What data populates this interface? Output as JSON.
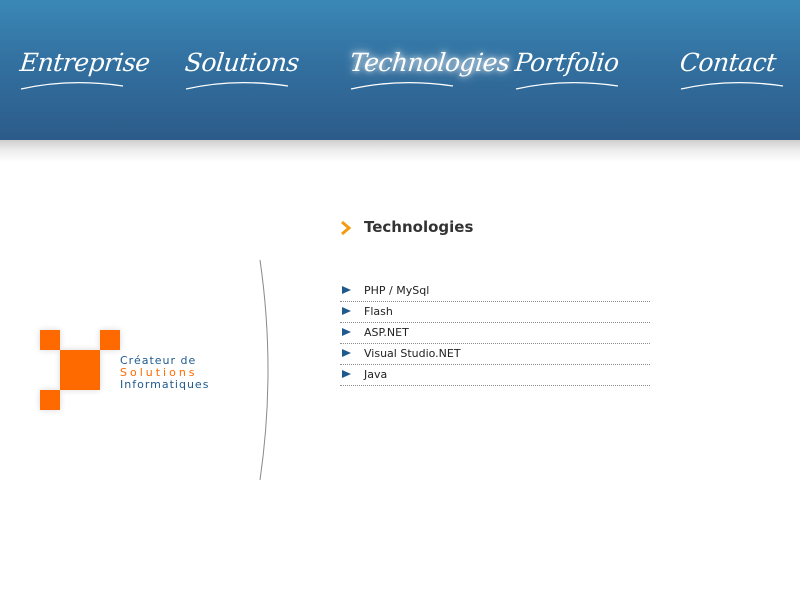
{
  "nav": {
    "items": [
      {
        "label": "Entreprise"
      },
      {
        "label": "Solutions"
      },
      {
        "label": "Technologies",
        "active": true
      },
      {
        "label": "Portfolio"
      },
      {
        "label": "Contact"
      }
    ]
  },
  "logo": {
    "line1": "Créateur de",
    "line2": "Solutions",
    "line3": "Informatiques",
    "colors": {
      "squares": "#ff6a00",
      "text_dark": "#1f5a8e",
      "text_accent": "#ff6a00"
    }
  },
  "section": {
    "title": "Technologies",
    "chevron_icon": "chevron-right-icon",
    "chevron_color": "#f39c12"
  },
  "technologies": [
    {
      "label": "PHP / MySql"
    },
    {
      "label": "Flash"
    },
    {
      "label": "ASP.NET"
    },
    {
      "label": "Visual Studio.NET"
    },
    {
      "label": "Java"
    }
  ],
  "theme": {
    "header_top": "#3a88b6",
    "header_bottom": "#2c5b89",
    "arrow_color": "#1f5a8e"
  }
}
